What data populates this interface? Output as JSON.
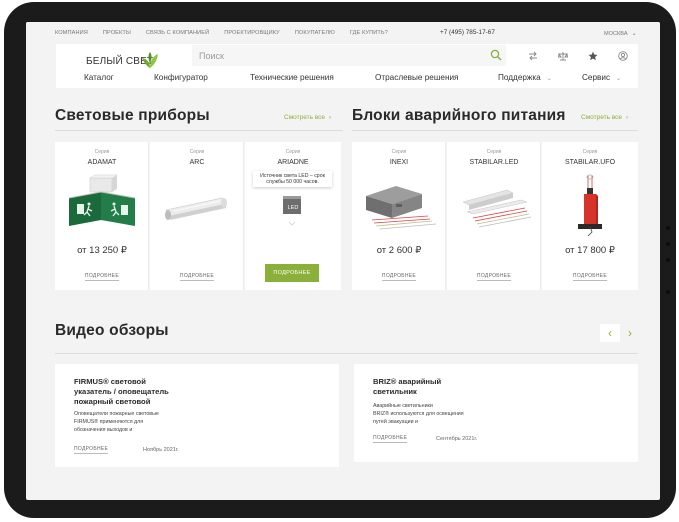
{
  "topbar": {
    "nav": [
      "КОМПАНИЯ",
      "ПРОЕКТЫ",
      "СВЯЗЬ С КОМПАНИЕЙ",
      "ПРОЕКТИРОВЩИКУ",
      "ПОКУПАТЕЛЮ",
      "ГДЕ КУПИТЬ?"
    ],
    "phone": "+7 (495) 785-17-67",
    "city": "МОСКВА"
  },
  "header": {
    "logo_text": "БЕЛЫЙ СВЕТ",
    "search_placeholder": "Поиск",
    "icons": [
      "compare-icon",
      "scales-icon",
      "star-icon",
      "user-icon"
    ]
  },
  "menu": [
    "Каталог",
    "Конфигуратор",
    "Технические решения",
    "Отраслевые решения",
    "Поддержка",
    "Сервис"
  ],
  "lighting": {
    "title": "Световые приборы",
    "see_all": "Смотреть все",
    "products": [
      {
        "series_label": "Серия",
        "name": "ADAMAT",
        "price": "от 13 250 ₽",
        "more": "ПОДРОБНЕЕ"
      },
      {
        "series_label": "Серия",
        "name": "ARC",
        "price": "",
        "more": "ПОДРОБНЕЕ"
      },
      {
        "series_label": "Серия",
        "name": "ARIADNE",
        "tooltip": "Источник света LED – срок службы 50 000 часов.",
        "badge": "LED",
        "button": "ПОДРОБНЕЕ"
      }
    ]
  },
  "emergency": {
    "title": "Блоки аварийного питания",
    "see_all": "Смотреть все",
    "products": [
      {
        "series_label": "Серия",
        "name": "INEXI",
        "price": "от 2 600 ₽",
        "more": "ПОДРОБНЕЕ"
      },
      {
        "series_label": "Серия",
        "name": "STABILAR.LED",
        "price": "",
        "more": "ПОДРОБНЕЕ"
      },
      {
        "series_label": "Серия",
        "name": "STABILAR.UFO",
        "price": "от 17 800 ₽",
        "more": "ПОДРОБНЕЕ"
      }
    ]
  },
  "videos": {
    "title": "Видео обзоры",
    "items": [
      {
        "title_lines": [
          "FIRMUS® световой",
          "указатель / оповещатель",
          "пожарный световой"
        ],
        "desc_lines": [
          "Оповещатели пожарные световые",
          "FIRMUS® применяются для",
          "обозначения выходов и"
        ],
        "more": "ПОДРОБНЕЕ",
        "date": "Ноябрь 2021г."
      },
      {
        "title_lines": [
          "BRIZ® аварийный",
          "светильник"
        ],
        "desc_lines": [
          "Аварийные светильники",
          "BRIZ® используются для освещения",
          "путей эвакуации и"
        ],
        "more": "ПОДРОБНЕЕ",
        "date": "Сентябрь 2021г."
      }
    ]
  },
  "colors": {
    "accent": "#8ab03a",
    "bezel": "#1b1b1b",
    "bg": "#f3f3f3"
  }
}
